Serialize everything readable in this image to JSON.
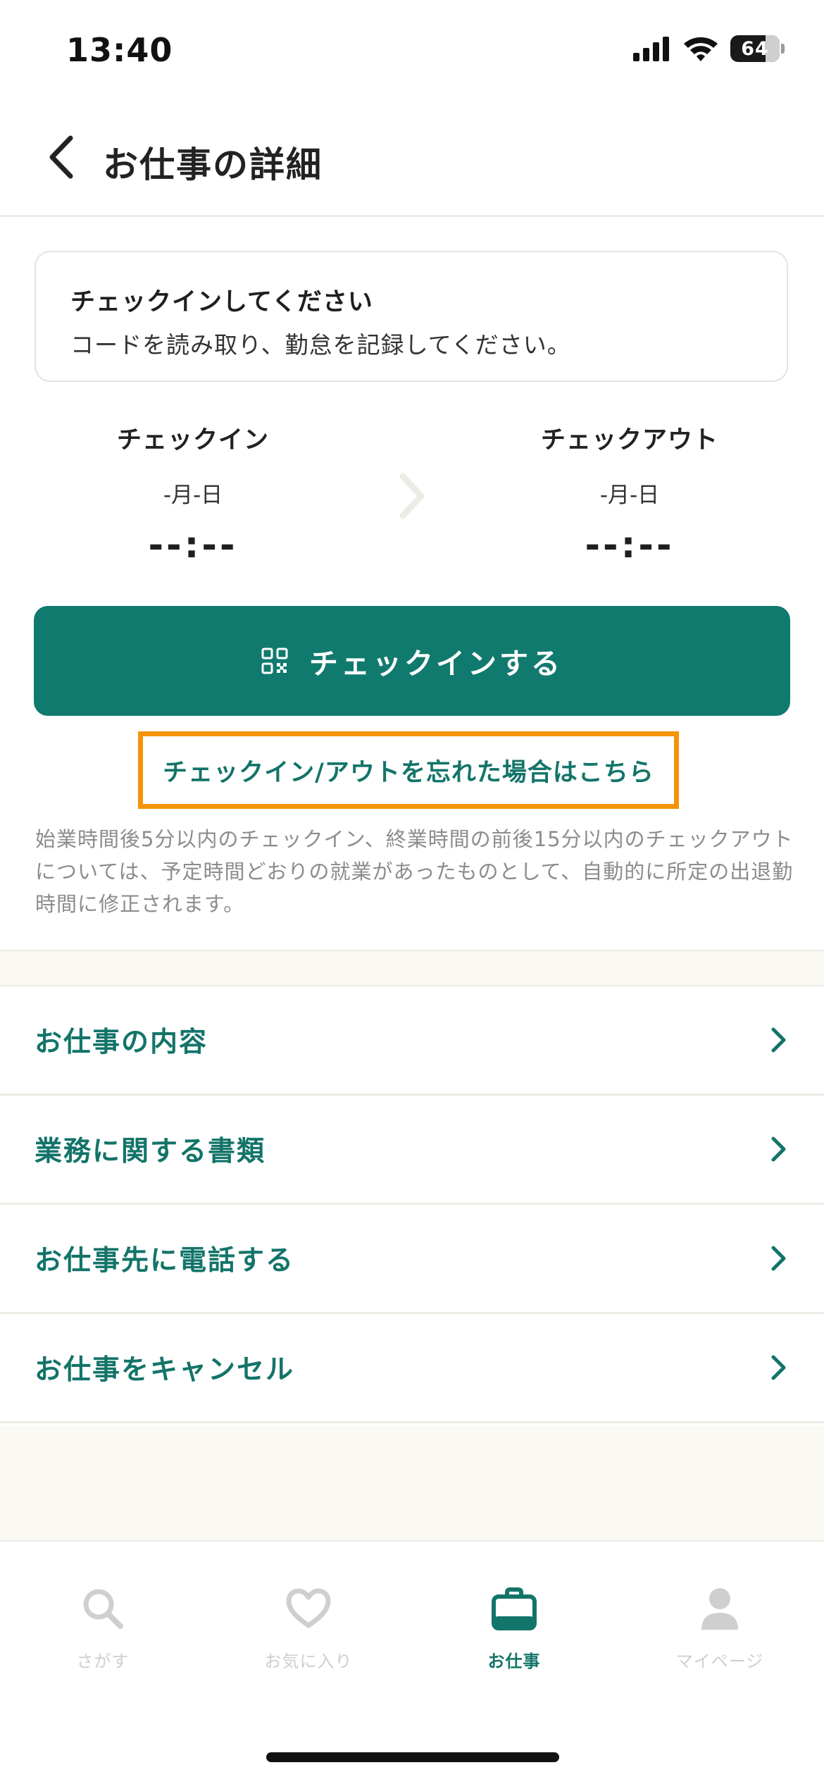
{
  "status_bar": {
    "time": "13:40",
    "battery": "64"
  },
  "header": {
    "title": "お仕事の詳細"
  },
  "info_card": {
    "title": "チェックインしてください",
    "description": "コードを読み取り、勤怠を記録してください。"
  },
  "checkin": {
    "label": "チェックイン",
    "date": "-月-日",
    "time": "--:--"
  },
  "checkout": {
    "label": "チェックアウト",
    "date": "-月-日",
    "time": "--:--"
  },
  "primary_button": {
    "label": "チェックインする"
  },
  "forgot_link": {
    "label": "チェックイン/アウトを忘れた場合はこちら"
  },
  "note": "始業時間後5分以内のチェックイン、終業時間の前後15分以内のチェックアウトについては、予定時間どおりの就業があったものとして、自動的に所定の出退勤時間に修正されます。",
  "menu": [
    {
      "label": "お仕事の内容"
    },
    {
      "label": "業務に関する書類"
    },
    {
      "label": "お仕事先に電話する"
    },
    {
      "label": "お仕事をキャンセル"
    }
  ],
  "tabs": [
    {
      "label": "さがす",
      "icon": "search-icon",
      "active": false
    },
    {
      "label": "お気に入り",
      "icon": "heart-icon",
      "active": false
    },
    {
      "label": "お仕事",
      "icon": "briefcase-icon",
      "active": true
    },
    {
      "label": "マイページ",
      "icon": "person-icon",
      "active": false
    }
  ],
  "colors": {
    "accent": "#117a6e",
    "link": "#137469",
    "highlight_border": "#f3940a",
    "inactive_tab": "#cfcfcf"
  }
}
